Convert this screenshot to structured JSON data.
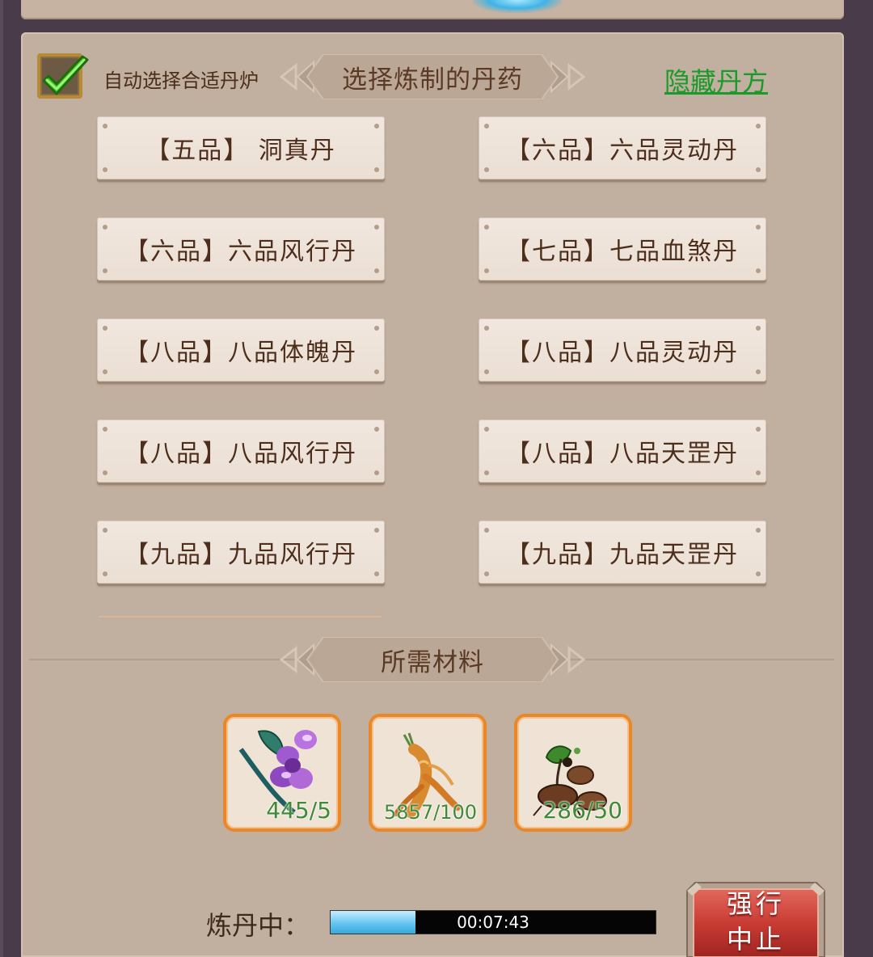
{
  "auto_select": {
    "label": "自动选择合适丹炉",
    "checked": true
  },
  "recipes_header": "选择炼制的丹药",
  "hide_recipes_link": "隐藏丹方",
  "recipes": [
    {
      "label": "【五品】 洞真丹"
    },
    {
      "label": "【六品】六品灵动丹"
    },
    {
      "label": "【六品】六品风行丹"
    },
    {
      "label": "【七品】七品血煞丹"
    },
    {
      "label": "【八品】八品体魄丹"
    },
    {
      "label": "【八品】八品灵动丹"
    },
    {
      "label": "【八品】八品风行丹"
    },
    {
      "label": "【八品】八品天罡丹"
    },
    {
      "label": "【九品】九品风行丹"
    },
    {
      "label": "【九品】九品天罡丹"
    }
  ],
  "materials_header": "所需材料",
  "materials": [
    {
      "icon": "purple-flower-icon",
      "count": "445/5"
    },
    {
      "icon": "ginseng-root-icon",
      "count": "5857/100"
    },
    {
      "icon": "tuber-herb-icon",
      "count": "286/50"
    }
  ],
  "progress": {
    "label": "炼丹中：",
    "time": "00:07:43",
    "fraction": 0.26
  },
  "stop_button": {
    "line1": "强行",
    "line2": "中止"
  },
  "colors": {
    "link": "#1a9a2a",
    "material_border": "#e9882b",
    "count": "#3f8a36",
    "stop_button": "#c93c34"
  }
}
